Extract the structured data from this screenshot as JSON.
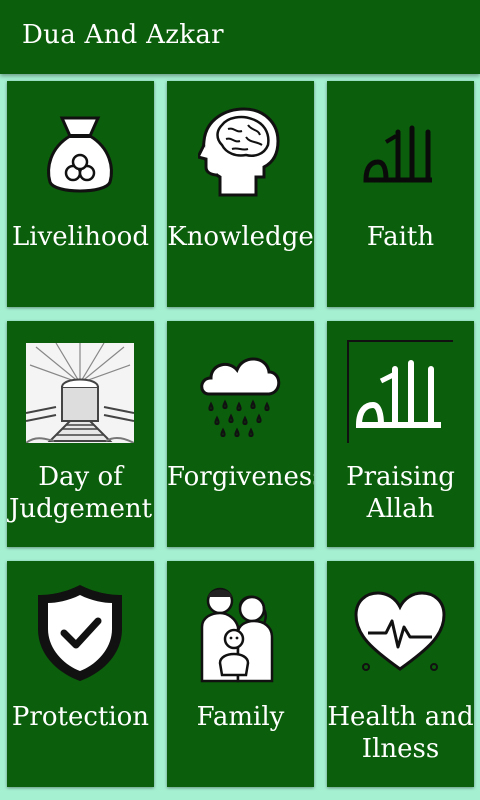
{
  "app_bar": {
    "title": "Dua And Azkar"
  },
  "categories": [
    {
      "label": "Livelihood",
      "icon": "money-bag-icon"
    },
    {
      "label": "Knowledge",
      "icon": "brain-head-icon"
    },
    {
      "label": "Faith",
      "icon": "allah-calligraphy-icon"
    },
    {
      "label": "Day of\nJudgement",
      "icon": "heaven-stairs-icon"
    },
    {
      "label": "Forgiveness",
      "icon": "rain-cloud-icon"
    },
    {
      "label": "Praising\nAllah",
      "icon": "allah-calligraphy-frame-icon"
    },
    {
      "label": "Protection",
      "icon": "shield-check-icon"
    },
    {
      "label": "Family",
      "icon": "family-icon"
    },
    {
      "label": "Health and\nIlness",
      "icon": "heart-pulse-icon"
    }
  ]
}
